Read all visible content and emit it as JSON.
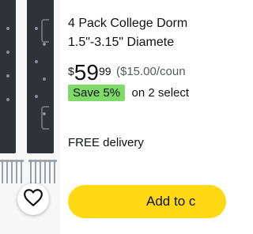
{
  "product": {
    "title_line1": "4 Pack College Dorm",
    "title_line2": "1.5\"-3.15\" Diamete",
    "price": {
      "currency_symbol": "$",
      "whole": "59",
      "cents": "99",
      "unit_price": "($15.00/coun"
    },
    "save": {
      "badge": "Save 5%",
      "detail": "on 2 select"
    },
    "delivery": "FREE delivery",
    "add_to_cart_label": "Add to c"
  },
  "icons": {
    "favorite": "heart-icon"
  },
  "colors": {
    "add_button": "#ffd814",
    "save_badge": "#7fda69",
    "text": "#0f1111",
    "muted_text": "#565959"
  }
}
